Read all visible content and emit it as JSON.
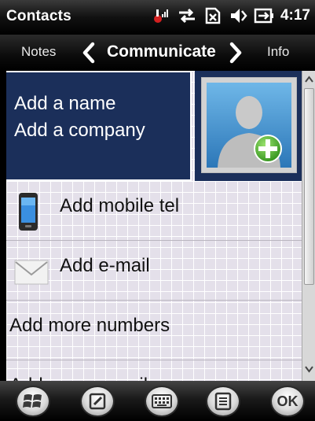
{
  "statusbar": {
    "app_title": "Contacts",
    "time": "4:17",
    "icons": [
      "signal-icon",
      "data-sync-icon",
      "no-sim-icon",
      "volume-icon",
      "battery-charging-icon"
    ]
  },
  "tabs": {
    "previous": "Notes",
    "current": "Communicate",
    "next": "Info"
  },
  "contact": {
    "name_placeholder": "Add a name",
    "company_placeholder": "Add a company",
    "photo_icon": "add-contact-photo-icon"
  },
  "fields": [
    {
      "label": "Add mobile tel",
      "icon": "mobile-phone-icon"
    },
    {
      "label": "Add e-mail",
      "icon": "envelope-icon"
    },
    {
      "label": "Add more numbers"
    },
    {
      "label": "Add more e-mail"
    }
  ],
  "softkeys": [
    {
      "name": "start-button",
      "icon": "windows-logo-icon"
    },
    {
      "name": "edit-button",
      "icon": "pencil-icon"
    },
    {
      "name": "keyboard-button",
      "icon": "keyboard-icon"
    },
    {
      "name": "menu-button",
      "icon": "menu-list-icon"
    },
    {
      "name": "ok-button",
      "label": "OK"
    }
  ],
  "colors": {
    "header_bg": "#1b2f5a",
    "content_bg": "#e4e0ea",
    "grid": "#ffffff",
    "add_badge": "#49b12c"
  }
}
